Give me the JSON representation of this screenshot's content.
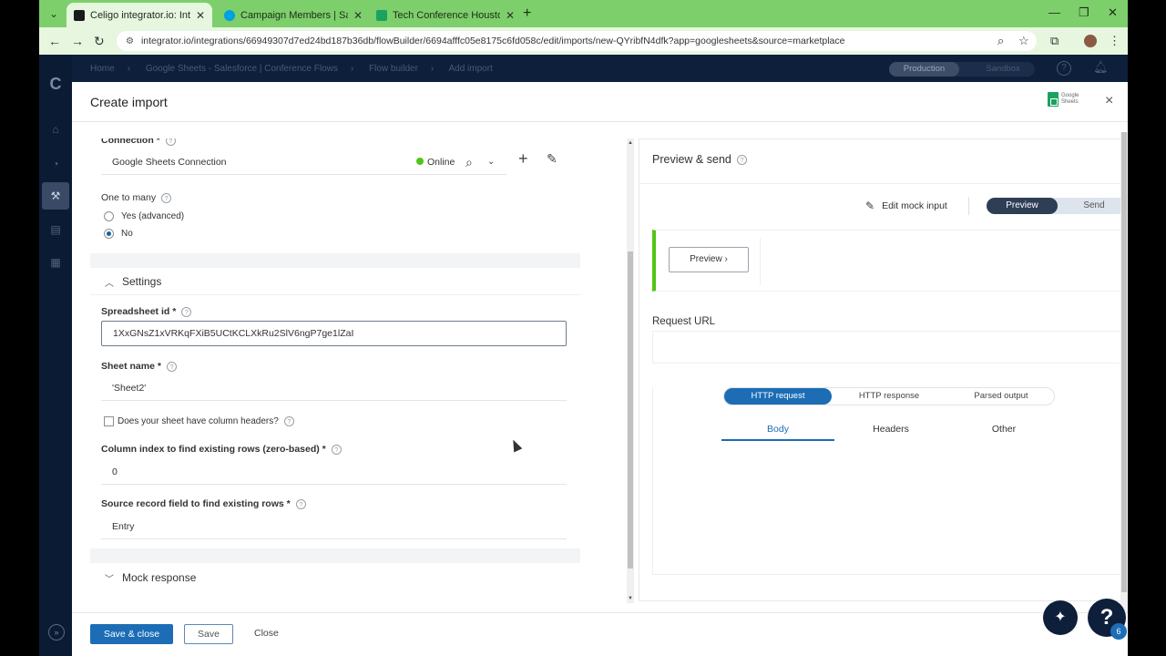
{
  "browser": {
    "tabs": [
      {
        "title": "Celigo integrator.io: Integration",
        "active": true,
        "favicon_color": "#1a1a1a"
      },
      {
        "title": "Campaign Members | Salesforce",
        "active": false,
        "favicon_color": "#00a1e0"
      },
      {
        "title": "Tech Conference Houston Testing",
        "active": false,
        "favicon_color": "#1aa260"
      }
    ],
    "new_tab": "+",
    "url": "integrator.io/integrations/66949307d7ed24bd187b36db/flowBuilder/6694afffc05e8175c6fd058c/edit/imports/new-QYribfN4dfk?app=googlesheets&source=marketplace"
  },
  "app": {
    "breadcrumbs": [
      "Home",
      "Google Sheets - Salesforce | Conference Flows",
      "Flow builder",
      "Add import"
    ],
    "env": {
      "active": "Production",
      "inactive": "Sandbox"
    },
    "logo": "C"
  },
  "drawer": {
    "title": "Create import",
    "app_logo_text": "Google Sheets",
    "close": "×"
  },
  "form": {
    "connection": {
      "label": "Connection *",
      "value": "Google Sheets Connection",
      "status": "Online",
      "status_color": "#52c41a"
    },
    "one_to_many": {
      "label": "One to many",
      "options": [
        "Yes (advanced)",
        "No"
      ],
      "selected": "No"
    },
    "settings_header": "Settings",
    "spreadsheet_id": {
      "label": "Spreadsheet id *",
      "value": "1XxGNsZ1xVRKqFXiB5UCtKCLXkRu2SlV6ngP7ge1lZaI"
    },
    "sheet_name": {
      "label": "Sheet name *",
      "value": "'Sheet2'"
    },
    "column_headers": {
      "label": "Does your sheet have column headers?",
      "checked": false
    },
    "column_index": {
      "label": "Column index to find existing rows (zero-based) *",
      "value": "0"
    },
    "source_field": {
      "label": "Source record field to find existing rows *",
      "value": "Entry"
    },
    "mock_response_header": "Mock response"
  },
  "preview": {
    "title": "Preview & send",
    "edit_mock": "Edit mock input",
    "toggle": {
      "active": "Preview",
      "inactive": "Send"
    },
    "preview_button": "Preview",
    "request_url_label": "Request URL",
    "tabs": [
      "HTTP request",
      "HTTP response",
      "Parsed output"
    ],
    "active_tab": "HTTP request",
    "subtabs": [
      "Body",
      "Headers",
      "Other"
    ],
    "active_subtab": "Body"
  },
  "footer": {
    "save_close": "Save & close",
    "save": "Save",
    "close": "Close",
    "help_badge": "6"
  },
  "colors": {
    "primary": "#1c6db5",
    "navy": "#0d1f3a",
    "chrome_green": "#7ccf6a"
  }
}
